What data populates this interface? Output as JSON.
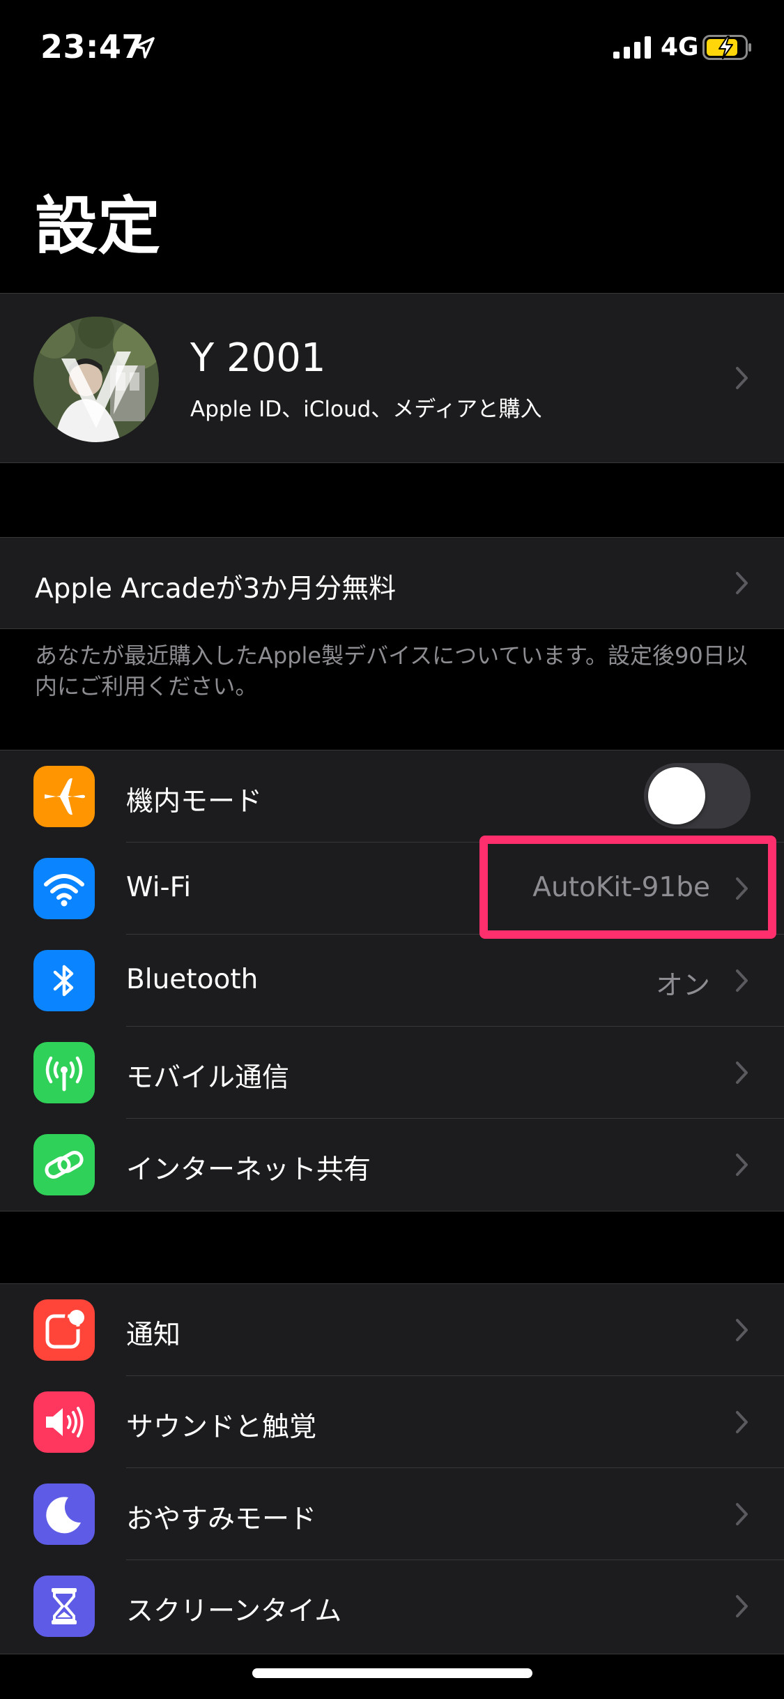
{
  "status_bar": {
    "time": "23:47",
    "network": "4G"
  },
  "page": {
    "title": "設定"
  },
  "profile": {
    "name": "Y 2001",
    "subtitle": "Apple ID、iCloud、メディアと購入"
  },
  "arcade": {
    "label": "Apple Arcadeが3か月分無料",
    "footer": "あなたが最近購入したApple製デバイスについています。設定後90日以内にご利用ください。"
  },
  "connectivity": [
    {
      "label": "機内モード",
      "value": "",
      "icon": "airplane-icon",
      "color": "#ff9500",
      "toggle": false
    },
    {
      "label": "Wi-Fi",
      "value": "AutoKit-91be",
      "icon": "wifi-icon",
      "color": "#0a84ff"
    },
    {
      "label": "Bluetooth",
      "value": "オン",
      "icon": "bluetooth-icon",
      "color": "#0a84ff"
    },
    {
      "label": "モバイル通信",
      "value": "",
      "icon": "antenna-icon",
      "color": "#30d158"
    },
    {
      "label": "インターネット共有",
      "value": "",
      "icon": "hotspot-icon",
      "color": "#30d158"
    }
  ],
  "system": [
    {
      "label": "通知",
      "icon": "notifications-icon",
      "color": "#ff453a"
    },
    {
      "label": "サウンドと触覚",
      "icon": "speaker-icon",
      "color": "#ff375f"
    },
    {
      "label": "おやすみモード",
      "icon": "moon-icon",
      "color": "#5e5ce6"
    },
    {
      "label": "スクリーンタイム",
      "icon": "hourglass-icon",
      "color": "#5e5ce6"
    }
  ],
  "colors": {
    "background": "#000000",
    "group": "#1c1c1e",
    "secondary_text": "#8d8d92",
    "highlight": "#ff2e6c"
  }
}
